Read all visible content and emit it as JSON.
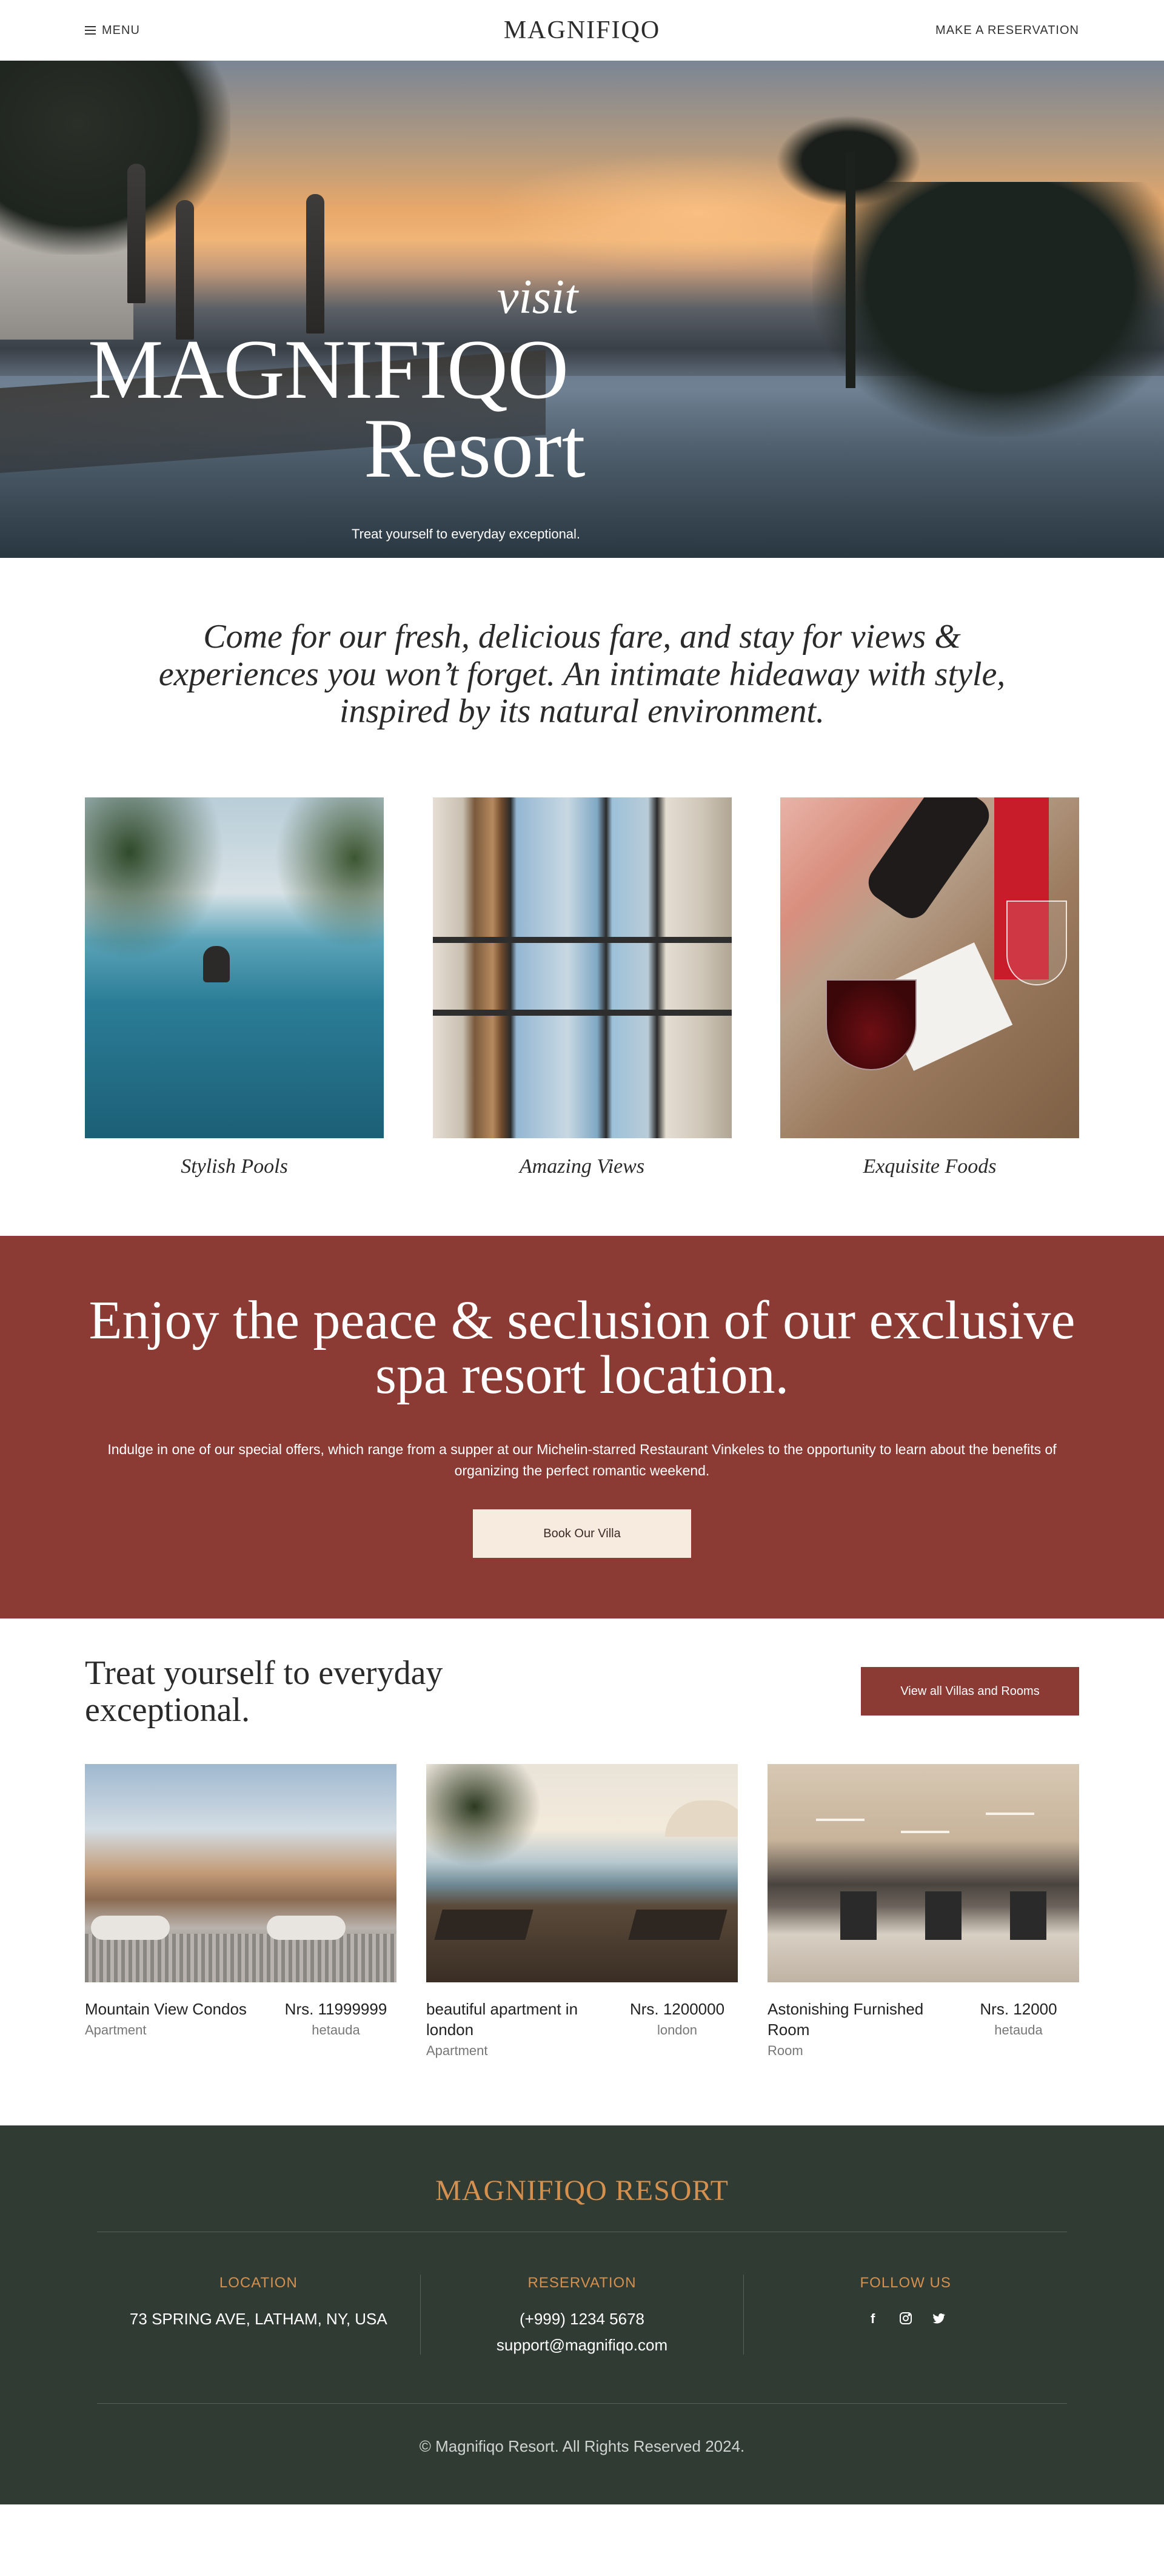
{
  "header": {
    "menu_label": "MENU",
    "logo": "MAGNIFIQO",
    "reserve_label": "MAKE A RESERVATION"
  },
  "hero": {
    "visit": "visit",
    "title": "MAGNIFIQO",
    "subtitle": "Resort",
    "tagline": "Treat yourself to everyday exceptional."
  },
  "intro": {
    "text": "Come for our fresh, delicious fare, and stay for views & experiences you won’t forget. An intimate hideaway with style, inspired by its natural environment."
  },
  "features": [
    {
      "caption": "Stylish Pools"
    },
    {
      "caption": "Amazing Views"
    },
    {
      "caption": "Exquisite Foods"
    }
  ],
  "cta": {
    "heading": "Enjoy the peace & seclusion of our exclusive spa resort location.",
    "body": "Indulge in one of our special offers, which range from a supper at our Michelin-starred Restaurant Vinkeles to the opportunity to learn about the benefits of organizing the perfect romantic weekend.",
    "button": "Book Our Villa"
  },
  "rooms_section": {
    "heading": "Treat yourself to everyday exceptional.",
    "view_all": "View all Villas and Rooms",
    "rooms": [
      {
        "name": "Mountain View Condos",
        "type": "Apartment",
        "price": "Nrs. 11999999",
        "location": "hetauda"
      },
      {
        "name": "beautiful apartment in london",
        "type": "Apartment",
        "price": "Nrs. 1200000",
        "location": "london"
      },
      {
        "name": "Astonishing Furnished Room",
        "type": "Room",
        "price": "Nrs. 12000",
        "location": "hetauda"
      }
    ]
  },
  "footer": {
    "brand": "MAGNIFIQO RESORT",
    "location_title": "LOCATION",
    "address": "73 SPRING AVE, LATHAM, NY, USA",
    "reservation_title": "RESERVATION",
    "phone": "(+999) 1234 5678",
    "email": "support@magnifiqo.com",
    "follow_title": "FOLLOW US",
    "socials": [
      "facebook-icon",
      "instagram-icon",
      "twitter-icon"
    ],
    "copyright": "© Magnifiqo Resort. All Rights Reserved 2024."
  },
  "colors": {
    "accent_red": "#8b3a34",
    "footer_green": "#2f3b33",
    "footer_accent": "#d4904f",
    "cta_button_bg": "#f7ebe0"
  }
}
